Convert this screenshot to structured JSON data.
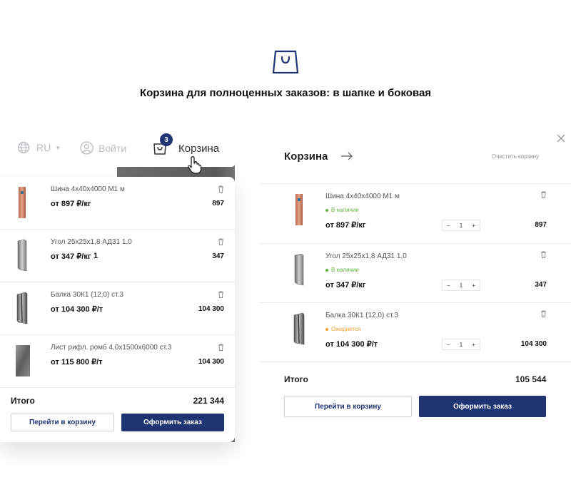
{
  "hero": {
    "title": "Корзина для полноценных заказов: в шапке и боковая"
  },
  "header": {
    "lang": "RU",
    "login": "Войти",
    "cart_label": "Корзина",
    "cart_count": "3"
  },
  "dropdown": {
    "items": [
      {
        "name": "Шина 4х40х4000 М1 м",
        "price": "от 897 ₽/кг",
        "qty": "",
        "sum": "897",
        "thumb": "copper"
      },
      {
        "name": "Угол 25х25х1,8 АД31 1,0",
        "price": "от 347 ₽/кг",
        "qty": "1",
        "sum": "347",
        "thumb": "angle"
      },
      {
        "name": "Балка 30К1 (12,0) ст.3",
        "price": "от 104 300 ₽/т",
        "qty": "",
        "sum": "104 300",
        "thumb": "beam"
      },
      {
        "name": "Лист рифл. ромб 4,0х1500х6000 ст.3",
        "price": "от 115 800 ₽/т",
        "qty": "",
        "sum": "104 300",
        "thumb": "sheet"
      }
    ],
    "total_label": "Итого",
    "total_value": "221 344",
    "btn_cart": "Перейти в корзину",
    "btn_order": "Оформить заказ"
  },
  "side_cart": {
    "title": "Корзина",
    "clear_label": "Очистить корзину",
    "items": [
      {
        "name": "Шина 4х40х4000 М1 м",
        "stock": "В наличии",
        "stock_color": "#5bb33a",
        "price": "от 897 ₽/кг",
        "qty": "1",
        "sum": "897",
        "thumb": "copper"
      },
      {
        "name": "Угол 25х25х1,8 АД31 1,0",
        "stock": "В наличии",
        "stock_color": "#5bb33a",
        "price": "от 347 ₽/кг",
        "qty": "1",
        "sum": "347",
        "thumb": "angle"
      },
      {
        "name": "Балка 30К1 (12,0) ст.3",
        "stock": "Ожидается",
        "stock_color": "#f0a030",
        "price": "от 104 300 ₽/т",
        "qty": "1",
        "sum": "104 300",
        "thumb": "beam"
      }
    ],
    "total_label": "Итого",
    "total_value": "105 544",
    "btn_cart": "Перейти в корзину",
    "btn_order": "Оформить заказ"
  },
  "colors": {
    "brand": "#1f3473",
    "in_stock": "#5bb33a",
    "expected": "#f0a030"
  }
}
